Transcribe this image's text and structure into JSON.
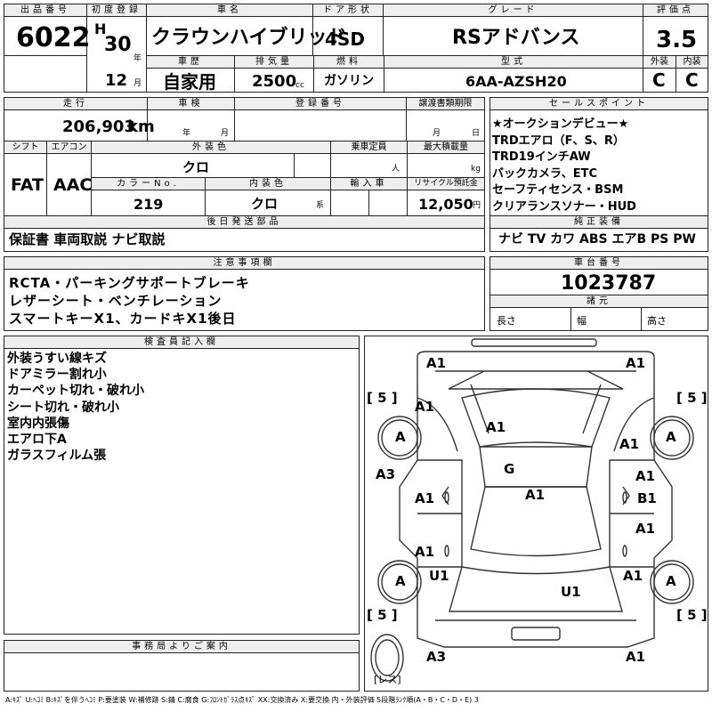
{
  "header": {
    "lot_no_label": "出品番号",
    "lot_no": "6022",
    "first_reg_label": "初度登録",
    "era": "H",
    "year": "30",
    "year_unit": "年",
    "month": "12",
    "month_unit": "月",
    "car_name_label": "車名",
    "car_name": "クラウンハイブリッド",
    "door_label": "ドア形状",
    "door": "4SD",
    "grade_label": "グレード",
    "grade": "RSアドバンス",
    "score_label": "評価点",
    "score": "3.5",
    "history_label": "車歴",
    "history": "自家用",
    "displacement_label": "排気量",
    "displacement": "2500",
    "displacement_unit": "cc",
    "fuel_label": "燃料",
    "fuel": "ガソリン",
    "model_label": "型式",
    "model": "6AA-AZSH20",
    "exterior_label": "外装",
    "exterior": "C",
    "interior_label": "内装",
    "interior": "C"
  },
  "mid": {
    "mileage_label": "走行",
    "mileage": "206,903",
    "mileage_unit": "km",
    "inspection_label": "車検",
    "insp_year_unit": "年",
    "insp_month_unit": "月",
    "reg_no_label": "登録番号",
    "transfer_label": "譲渡書類期限",
    "transfer_month_unit": "月",
    "transfer_day_unit": "日",
    "shift_label": "シフト",
    "shift": "FAT",
    "ac_label": "エアコン",
    "ac": "AAC",
    "ext_color_label": "外装色",
    "ext_color": "クロ",
    "capacity_label": "乗車定員",
    "capacity_unit": "人",
    "max_load_label": "最大積載量",
    "max_load_unit": "kg",
    "color_no_label": "カラーNo.",
    "color_no": "219",
    "int_color_label": "内装色",
    "int_color": "クロ",
    "int_color_unit": "系",
    "import_label": "輸入車",
    "recycle_label": "リサイクル預託金",
    "recycle": "12,050",
    "recycle_unit": "円",
    "later_label": "後日発送部品",
    "later": "保証書 車両取説 ナビ取説"
  },
  "sales": {
    "label": "セールスポイント",
    "items": [
      "★オークションデビュー★",
      "TRDエアロ（F、S、R）",
      "TRD19インチAW",
      "バックカメラ、ETC",
      "セーフティセンス・BSM",
      "クリアランスソナー・HUD"
    ]
  },
  "equipment": {
    "label": "純正装備",
    "text": "ナビ TV カワ ABS エアB PS PW"
  },
  "caution": {
    "label": "注意事項欄",
    "lines": [
      "RCTA・パーキングサポートブレーキ",
      "レザーシート・ベンチレーション",
      "スマートキーX1、カードキX1後日"
    ]
  },
  "chassis": {
    "label": "車台番号",
    "value": "1023787",
    "spec_label": "諸元",
    "length_label": "長さ",
    "width_label": "幅",
    "height_label": "高さ"
  },
  "inspector": {
    "label": "検査員記入欄",
    "lines": [
      "外装うすい線キズ",
      "ドアミラー割れ小",
      "カーペット切れ・破れ小",
      "シート切れ・破れ小",
      "室内内張傷",
      "エアロ下A",
      "ガラスフィルム張"
    ]
  },
  "office": {
    "label": "事務局よりご案内"
  },
  "footer": {
    "legend": "A:ｷｽﾞ U:ﾍｺﾐ B:ｷｽﾞを伴うﾍｺﾐ P:要塗装 W:補修跡 S:錆 C:腐食 G:ﾌﾛﾝﾄｶﾞﾗｽ点ｷｽﾞ XX:交換済み X:要交換 内・外装評価 5段階ﾗﾝｸ順(A・B・C・D・E) 3"
  },
  "chart_data": {
    "type": "table",
    "diagram_marks": {
      "front_left_corner": "A1",
      "front_right_corner": "A1",
      "hood_left": "A1",
      "windshield": "A1",
      "front_right_fender": "A1",
      "left_front_wheel": "A",
      "right_front_wheel": "A",
      "left_front_door_side": "A3",
      "roof_glass": "G",
      "roof": "A1",
      "left_front_door": "A1",
      "right_front_door_1": "A1",
      "right_front_door_2": "B1",
      "left_rear_door": "A1",
      "right_rear_door": "A1",
      "left_rear_wheel": "A",
      "right_rear_wheel": "A",
      "left_rear_fender": "U1",
      "trunk": "U1",
      "right_rear_fender": "A1",
      "rear_left_corner": "A3",
      "rear_right_corner": "A1",
      "tire_depth": "5",
      "spare_label": "レス"
    }
  }
}
